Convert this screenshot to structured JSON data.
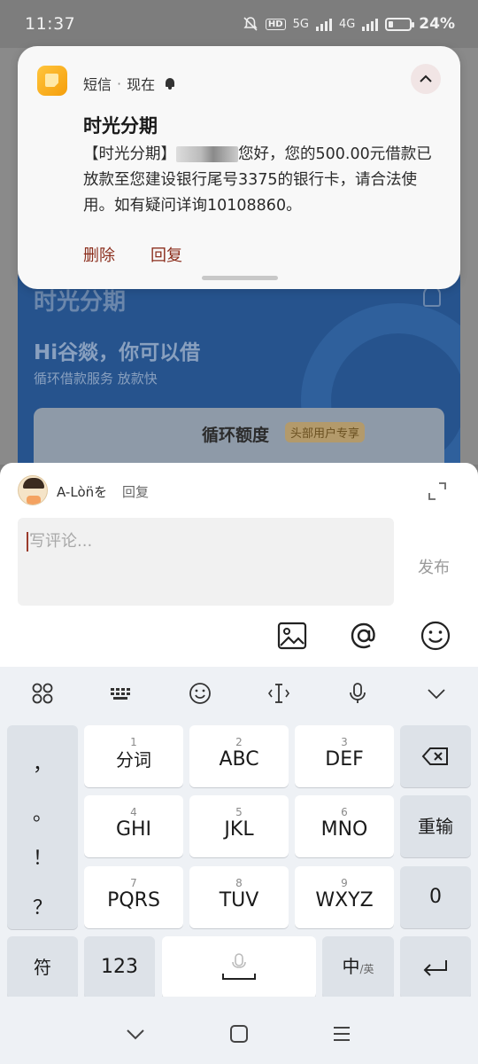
{
  "status_bar": {
    "time": "11:37",
    "network_5g": "5G",
    "network_4g": "4G",
    "hd_label": "HD",
    "battery_percent": "24%",
    "battery_level": 0.24
  },
  "background_app": {
    "banner_title": "时光分期",
    "greeting": "Hi谷燚，你可以借",
    "subtitle": "循环借款服务 放款快",
    "card_title": "循环额度",
    "card_tag": "头部用户专享"
  },
  "notification": {
    "app_name": "短信",
    "separator": "·",
    "time": "现在",
    "title": "时光分期",
    "body_prefix": "【时光分期】",
    "body_text": "您好，您的500.00元借款已放款至您建设银行尾号3375的银行卡，请合法使用。如有疑问详询10108860。",
    "actions": [
      "删除",
      "回复"
    ]
  },
  "comment": {
    "reply_to_user": "A-Lòn̈を",
    "reply_label": "回复",
    "input_placeholder": "写评论...",
    "publish_label": "发布",
    "tools": [
      "image-icon",
      "at-icon",
      "emoji-icon"
    ]
  },
  "keyboard": {
    "toolbar": [
      "grid-icon",
      "keyboard-icon",
      "emoji-icon",
      "cursor-icon",
      "microphone-icon",
      "chevron-down-icon"
    ],
    "punctuation": [
      "，",
      "。",
      "！",
      "？"
    ],
    "keys": [
      {
        "num": "1",
        "label": "分词"
      },
      {
        "num": "2",
        "label": "ABC"
      },
      {
        "num": "3",
        "label": "DEF"
      },
      {
        "num": "4",
        "label": "GHI"
      },
      {
        "num": "5",
        "label": "JKL"
      },
      {
        "num": "6",
        "label": "MNO"
      },
      {
        "num": "7",
        "label": "PQRS"
      },
      {
        "num": "8",
        "label": "TUV"
      },
      {
        "num": "9",
        "label": "WXYZ"
      }
    ],
    "reinput_label": "重输",
    "zero_label": "0",
    "symbol_label": "符",
    "num_label": "123",
    "lang_main": "中",
    "lang_sub": "/英"
  },
  "nav": [
    "back-icon",
    "home-icon",
    "recents-icon"
  ]
}
